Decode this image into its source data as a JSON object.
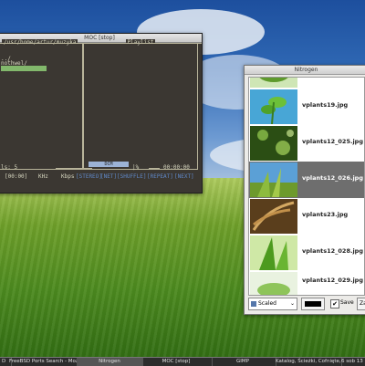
{
  "moc": {
    "title": "MOC [stop]",
    "path": "/usr/home/artur/muzyka",
    "playlist_title": "Playlist",
    "lines": [
      "../",
      "nothwel/"
    ],
    "vol_label": "ls: 5",
    "time_left": "[00:00]",
    "khz": "KHz",
    "kbps": "Kbps",
    "stereo": "[STEREO]",
    "net": "[NET]",
    "shuffle": "[SHUFFLE]",
    "repeat": "[REPEAT]",
    "next": "[NEXT]",
    "progress_label": "DCM",
    "progress_sep": "|%",
    "time_total": "00:00:00"
  },
  "nitrogen": {
    "title": "Nitrogen",
    "items": [
      {
        "file": "",
        "thumb": "plant"
      },
      {
        "file": "vplants19.jpg",
        "thumb": "sprout"
      },
      {
        "file": "vplants12_025.jpg",
        "thumb": "bokeh"
      },
      {
        "file": "vplants12_026.jpg",
        "thumb": "grass",
        "selected": true
      },
      {
        "file": "vplants23.jpg",
        "thumb": "wheat"
      },
      {
        "file": "vplants12_028.jpg",
        "thumb": "blade"
      },
      {
        "file": "vplants12_029.jpg",
        "thumb": "leaf"
      }
    ],
    "mode": "Scaled",
    "save_label": "Save",
    "apply_label": "Zast",
    "save_checked": true
  },
  "taskbar": {
    "tasks": [
      {
        "label": "D",
        "active": false
      },
      {
        "label": "FreeBSD Ports Search - Mozilla",
        "active": false
      },
      {
        "label": "Nitrogen",
        "active": true
      },
      {
        "label": "MOC [stop]",
        "active": false
      },
      {
        "label": "GIMP",
        "active": false
      },
      {
        "label": "Katalog, Ścieżki, Cofnięte, Warstwy",
        "active": false
      }
    ],
    "clock": "6 sob 13"
  },
  "colors": {
    "moc_bg": "#3b3732",
    "moc_selected": "#82b86c",
    "nitrogen_selected": "#6e6e6e"
  }
}
